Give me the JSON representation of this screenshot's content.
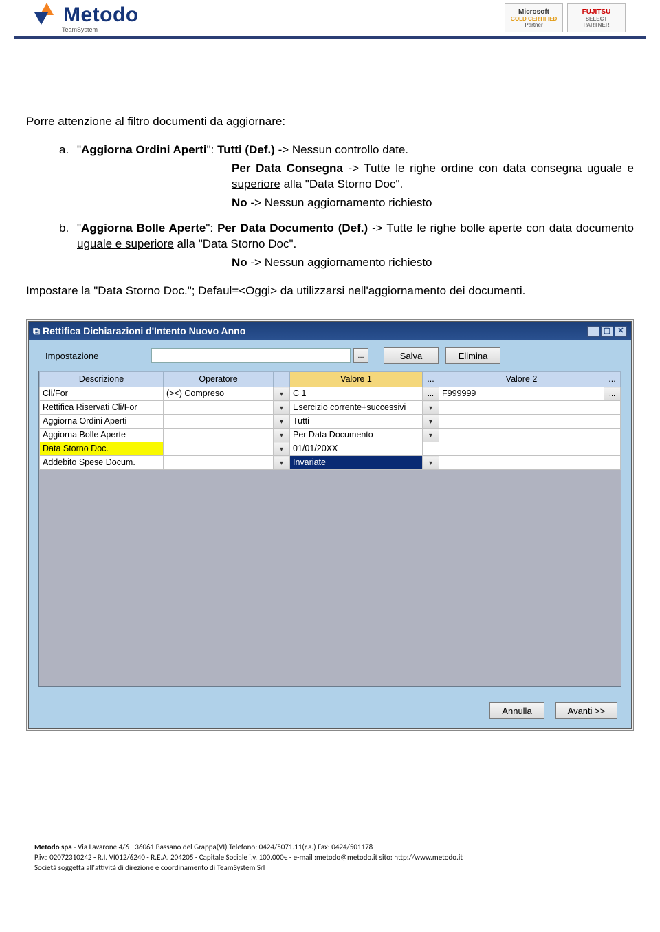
{
  "header": {
    "logo_text": "Metodo",
    "team": "TeamSystem",
    "badge1_l1": "Microsoft",
    "badge1_l2": "GOLD CERTIFIED",
    "badge1_l3": "Partner",
    "badge2_l1": "FUJITSU",
    "badge2_l2": "SELECT PARTNER"
  },
  "body": {
    "intro": "Porre attenzione al filtro documenti da aggiornare:",
    "item_a_letter": "a.",
    "item_a_pre": "\"",
    "item_a_name": "Aggiorna Ordini Aperti",
    "item_a_mid": "\": ",
    "item_a_val": "Tutti (Def.)",
    "item_a_post": " -> Nessun controllo date.",
    "item_a_c1": "Per Data Consegna",
    "item_a_c1b": " -> Tutte le righe ordine con data consegna ",
    "item_a_c1u": "uguale e superiore",
    "item_a_c1c": " alla \"Data Storno Doc\".",
    "item_a_c2": "No",
    "item_a_c2b": " -> Nessun aggiornamento richiesto",
    "item_b_letter": "b.",
    "item_b_name": "Aggiorna Bolle Aperte",
    "item_b_val": "Per Data Documento (Def.)",
    "item_b_post": " -> Tutte le righe bolle aperte con data documento ",
    "item_b_u": "uguale e superiore",
    "item_b_post2": " alla \"Data Storno Doc\".",
    "item_b_c2": "No",
    "item_b_c2b": " -> Nessun aggiornamento richiesto",
    "p2": "Impostare la  \"Data Storno Doc.\"; Defaul=<Oggi> da utilizzarsi nell'aggiornamento dei documenti."
  },
  "win": {
    "title": "Rettifica Dichiarazioni d'Intento Nuovo Anno",
    "impostazione": "Impostazione",
    "salva": "Salva",
    "elimina": "Elimina",
    "annulla": "Annulla",
    "avanti": "Avanti >>",
    "cols": {
      "desc": "Descrizione",
      "op": "Operatore",
      "v1": "Valore 1",
      "dots": "...",
      "v2": "Valore 2"
    },
    "rows": [
      {
        "desc": "Cli/For",
        "op": "(><) Compreso",
        "v1": "C   1",
        "v1btn": "...",
        "v2": "F999999",
        "v2btn": "..."
      },
      {
        "desc": "Rettifica Riservati Cli/For",
        "op": "",
        "v1": "Esercizio corrente+successivi",
        "v1btn": "dd",
        "v2": ""
      },
      {
        "desc": "Aggiorna Ordini Aperti",
        "op": "",
        "v1": "Tutti",
        "v1btn": "dd",
        "v2": ""
      },
      {
        "desc": "Aggiorna Bolle Aperte",
        "op": "",
        "v1": "Per Data Documento",
        "v1btn": "dd",
        "v2": ""
      },
      {
        "desc": "Data Storno Doc.",
        "op": "",
        "v1": "01/01/20XX",
        "v1btn": "",
        "v2": "",
        "descClass": "yellow"
      },
      {
        "desc": "Addebito Spese Docum.",
        "op": "",
        "v1": "Invariate",
        "v1btn": "dd",
        "v2": "",
        "v1Class": "selrow"
      }
    ]
  },
  "footer": {
    "l1a": "Metodo spa  -  ",
    "l1b": "Via Lavarone 4/6 - 36061 Bassano del Grappa(VI) Telefono: 0424/5071.11(r.a.) Fax: 0424/501178",
    "l2": "P.iva 02072310242 - R.I. VI012/6240 - R.E.A. 204205 - Capitale Sociale i.v. 100.000€ - e-mail :metodo@metodo.it sito: http://www.metodo.it",
    "l3": "Società soggetta all'attività di direzione e coordinamento di TeamSystem Srl"
  }
}
